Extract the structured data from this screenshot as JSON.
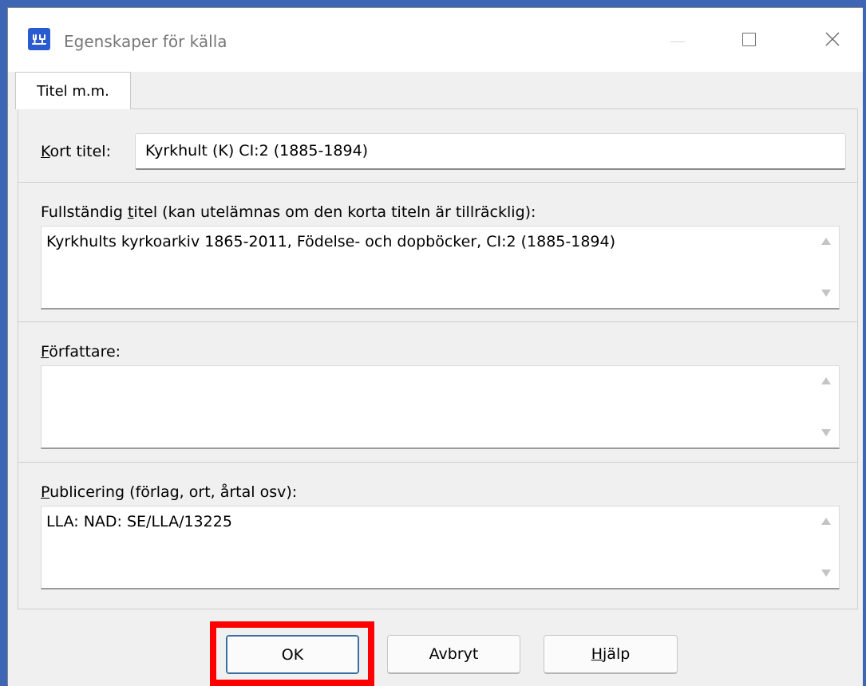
{
  "window": {
    "title": "Egenskaper för källa",
    "icon": "app-icon"
  },
  "tabs": [
    {
      "label": "Titel m.m.",
      "active": true
    }
  ],
  "fields": {
    "short_title": {
      "label_prefix": "",
      "label_accel": "K",
      "label_rest": "ort titel:",
      "value": "Kyrkhult (K) CI:2 (1885-1894)"
    },
    "full_title": {
      "label_pre": "Fullständig ",
      "label_accel": "t",
      "label_rest": "itel (kan utelämnas om den korta titeln är tillräcklig):",
      "value": "Kyrkhults kyrkoarkiv 1865-2011, Födelse- och dopböcker, CI:2 (1885-1894)"
    },
    "author": {
      "label_accel": "F",
      "label_rest": "örfattare:",
      "value": ""
    },
    "publication": {
      "label_accel": "P",
      "label_rest": "ublicering (förlag, ort, årtal osv):",
      "value": "LLA: NAD: SE/LLA/13225"
    }
  },
  "buttons": {
    "ok": "OK",
    "cancel": "Avbryt",
    "help_accel": "H",
    "help_rest": "jälp"
  },
  "colors": {
    "accent": "#3a6ea0",
    "highlight": "#ff0000",
    "backdrop": "#3f66b4"
  }
}
